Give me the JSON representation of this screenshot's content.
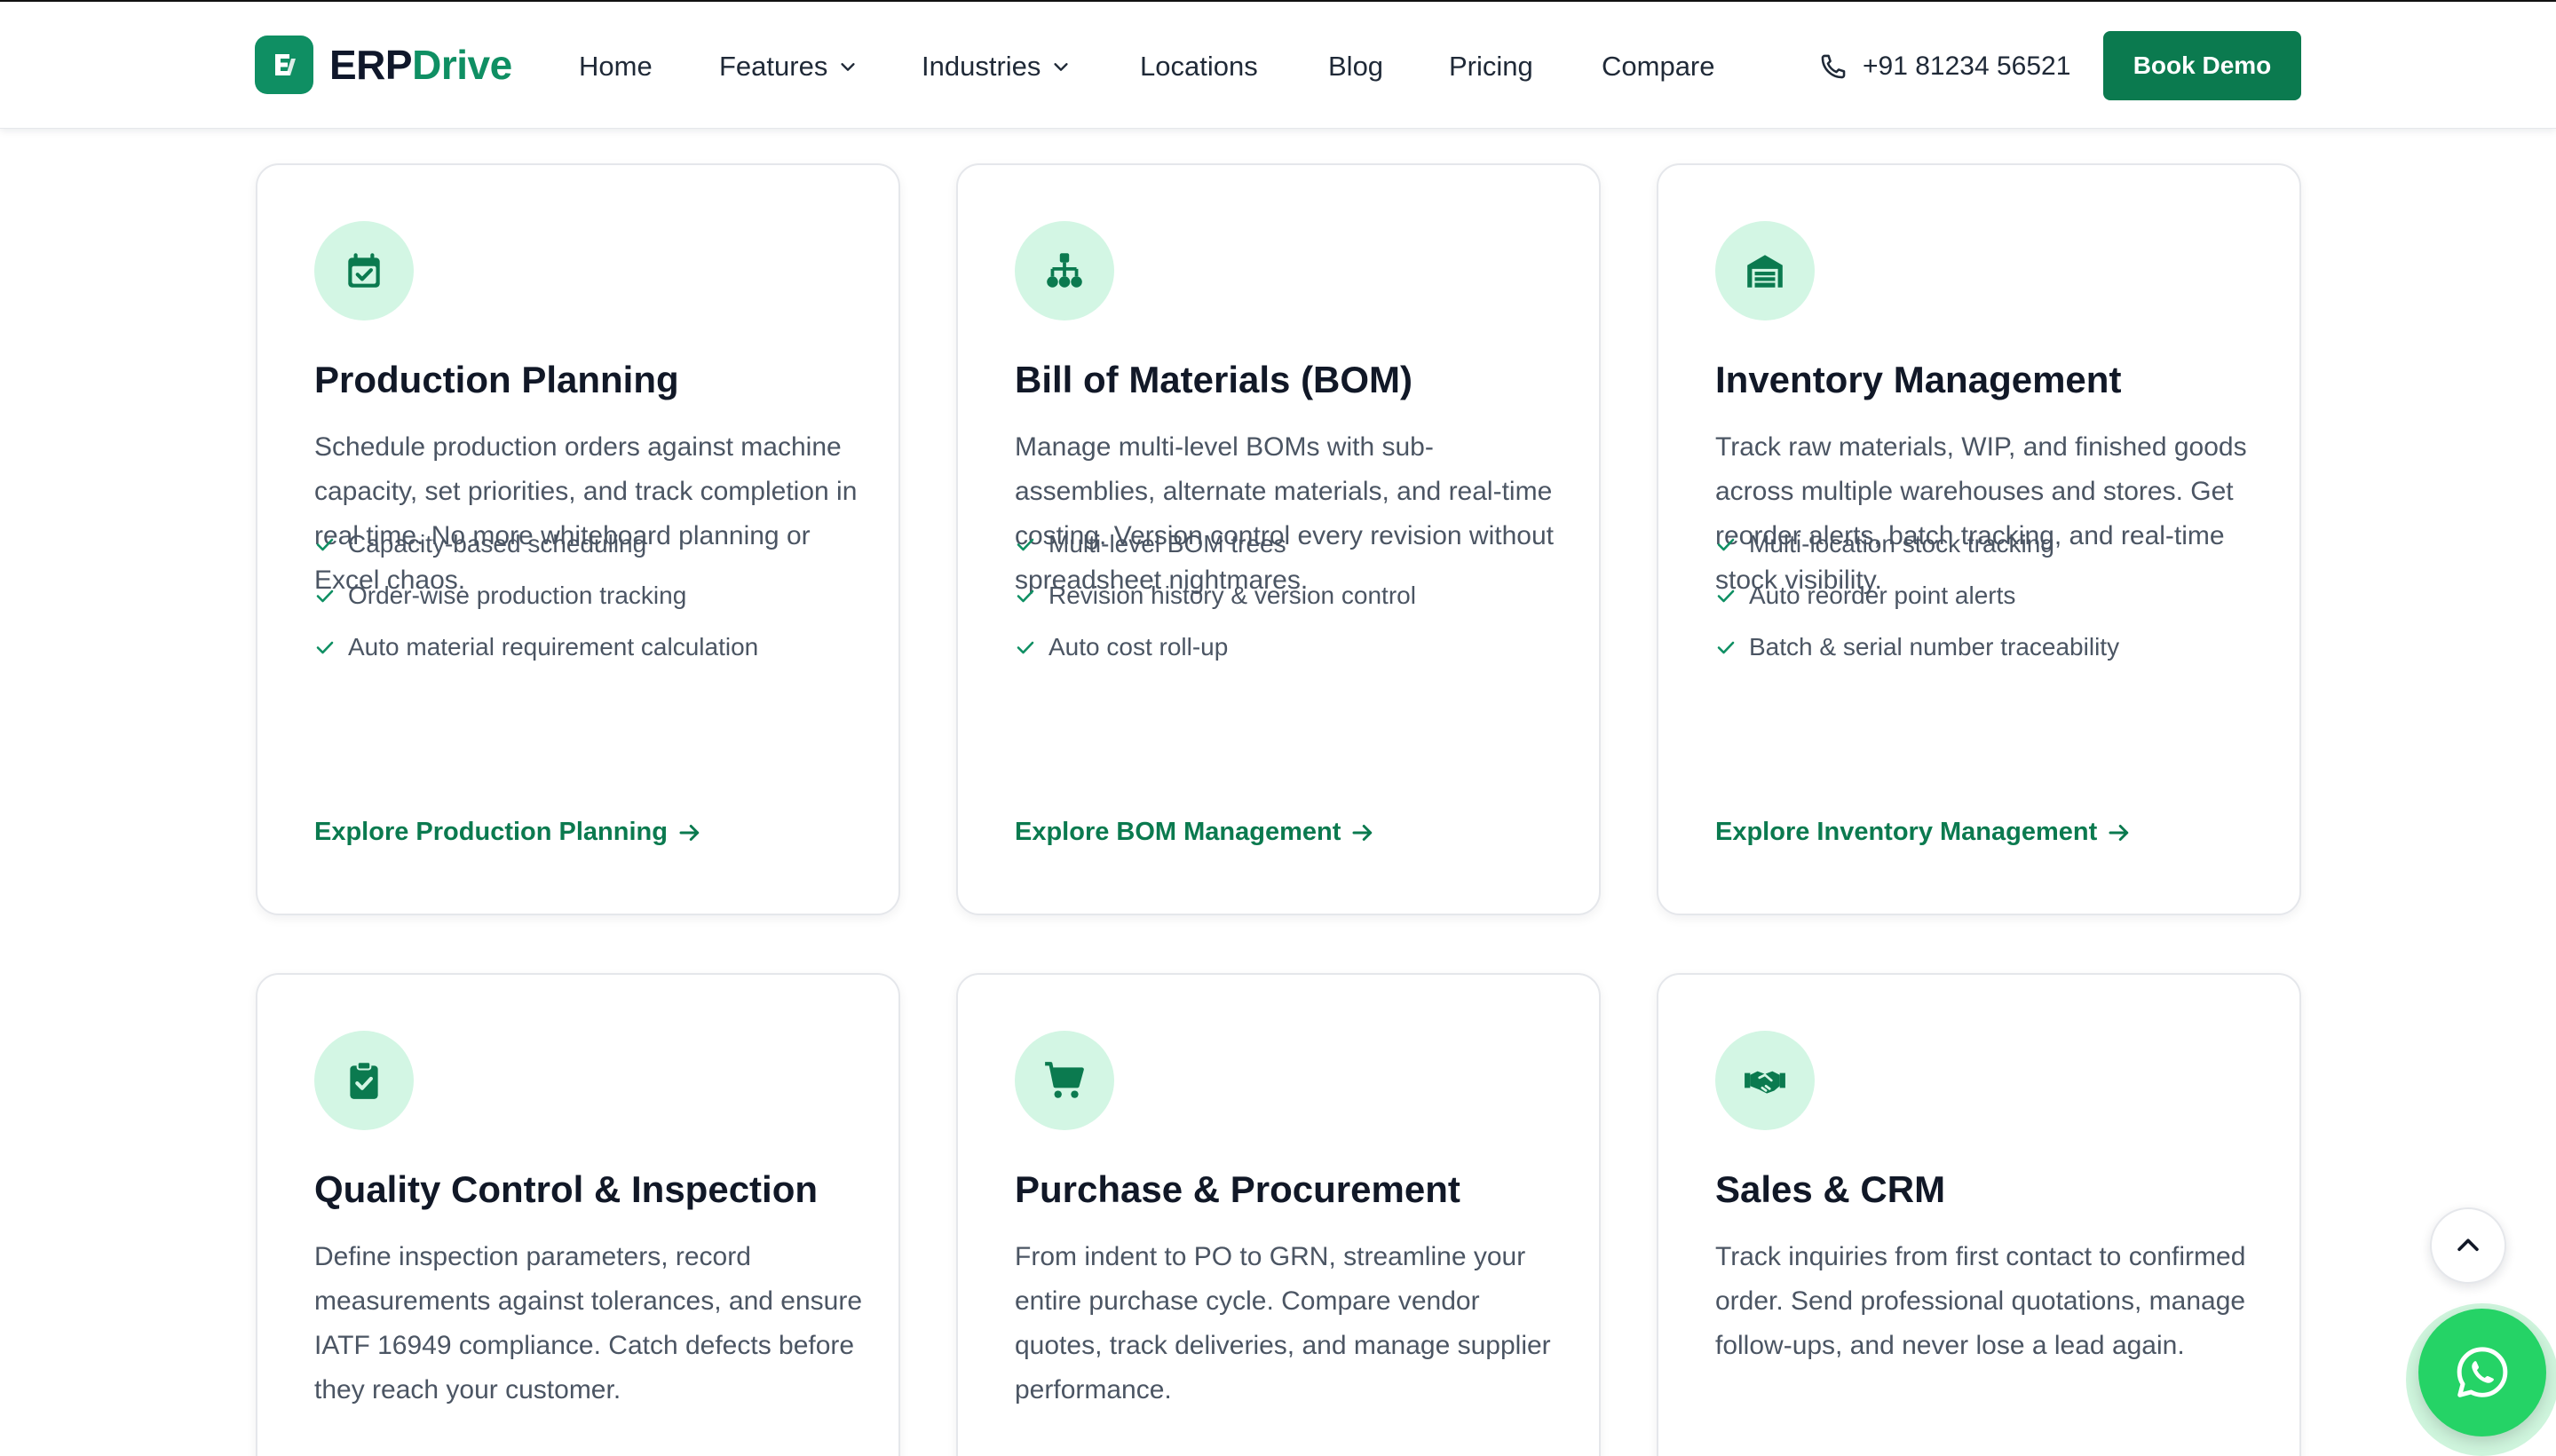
{
  "brand": {
    "name_part1": "ERP",
    "name_part2": "Drive",
    "logo_icon": "erpdrive-logo-icon",
    "color": "#0f8f63"
  },
  "nav": {
    "items": [
      {
        "label": "Home",
        "has_dropdown": false
      },
      {
        "label": "Features",
        "has_dropdown": true
      },
      {
        "label": "Industries",
        "has_dropdown": true
      },
      {
        "label": "Locations",
        "has_dropdown": false
      },
      {
        "label": "Blog",
        "has_dropdown": false
      },
      {
        "label": "Pricing",
        "has_dropdown": false
      },
      {
        "label": "Compare",
        "has_dropdown": false
      }
    ],
    "phone": "+91 81234 56521",
    "phone_icon": "phone-icon",
    "cta_label": "Book Demo",
    "cta_color": "#0b7a4f"
  },
  "cards": [
    {
      "icon": "calendar-check-icon",
      "title": "Production Planning",
      "description": "Schedule production orders against machine capacity, set priorities, and track completion in real time. No more whiteboard planning or Excel chaos.",
      "features": [
        "Capacity-based scheduling",
        "Order-wise production tracking",
        "Auto material requirement calculation"
      ],
      "link": "Explore Production Planning"
    },
    {
      "icon": "sitemap-icon",
      "title": "Bill of Materials (BOM)",
      "description": "Manage multi-level BOMs with sub-assemblies, alternate materials, and real-time costing. Version control every revision without spreadsheet nightmares.",
      "features": [
        "Multi-level BOM trees",
        "Revision history & version control",
        "Auto cost roll-up"
      ],
      "link": "Explore BOM Management"
    },
    {
      "icon": "warehouse-icon",
      "title": "Inventory Management",
      "description": "Track raw materials, WIP, and finished goods across multiple warehouses and stores. Get reorder alerts, batch tracking, and real-time stock visibility.",
      "features": [
        "Multi-location stock tracking",
        "Auto reorder point alerts",
        "Batch & serial number traceability"
      ],
      "link": "Explore Inventory Management"
    },
    {
      "icon": "clipboard-check-icon",
      "title": "Quality Control & Inspection",
      "description": "Define inspection parameters, record measurements against tolerances, and ensure IATF 16949 compliance. Catch defects before they reach your customer.",
      "features": [],
      "link": ""
    },
    {
      "icon": "shopping-cart-icon",
      "title": "Purchase & Procurement",
      "description": "From indent to PO to GRN, streamline your entire purchase cycle. Compare vendor quotes, track deliveries, and manage supplier performance.",
      "features": [],
      "link": ""
    },
    {
      "icon": "handshake-icon",
      "title": "Sales & CRM",
      "description": "Track inquiries from first contact to confirmed order. Send professional quotations, manage follow-ups, and never lose a lead again.",
      "features": [],
      "link": ""
    }
  ],
  "floating": {
    "scroll_top_icon": "chevron-up-icon",
    "whatsapp_icon": "whatsapp-icon",
    "whatsapp_color": "#25d366"
  },
  "colors": {
    "accent": "#0b7a4f",
    "icon_bg": "#d3f6e4",
    "text": "#111827",
    "muted": "#4b5563"
  }
}
